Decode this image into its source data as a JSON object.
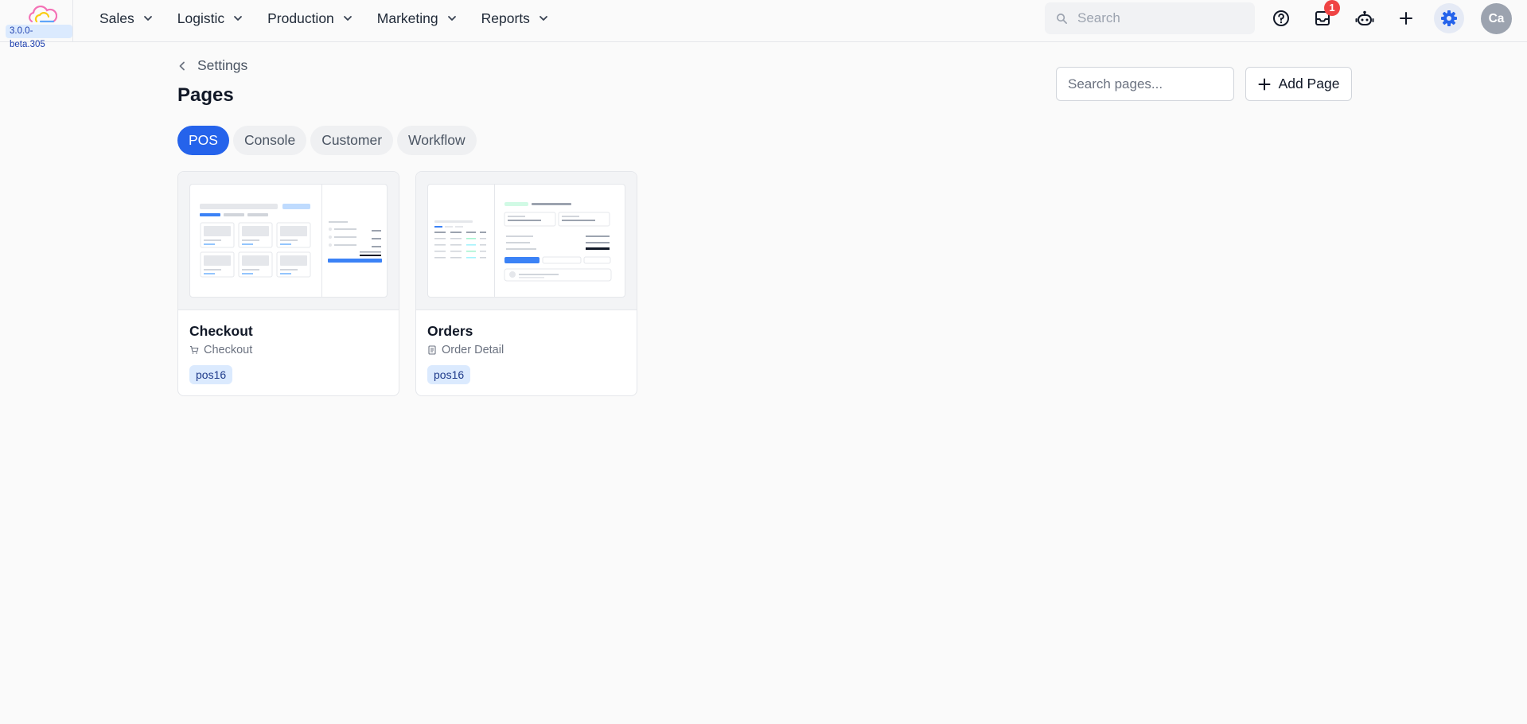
{
  "app": {
    "version": "3.0.0-beta.305"
  },
  "nav": {
    "items": [
      {
        "label": "Sales"
      },
      {
        "label": "Logistic"
      },
      {
        "label": "Production"
      },
      {
        "label": "Marketing"
      },
      {
        "label": "Reports"
      }
    ]
  },
  "topbar": {
    "search_placeholder": "Search",
    "inbox_badge": "1",
    "avatar_initials": "Ca",
    "icons": [
      "help-icon",
      "inbox-icon",
      "bot-icon",
      "plus-icon",
      "gear-icon"
    ],
    "accent_color": "#2563eb"
  },
  "header": {
    "back_label": "Settings",
    "title": "Pages",
    "search_placeholder": "Search pages...",
    "add_label": "Add Page"
  },
  "tabs": [
    {
      "label": "POS",
      "active": true
    },
    {
      "label": "Console",
      "active": false
    },
    {
      "label": "Customer",
      "active": false
    },
    {
      "label": "Workflow",
      "active": false
    }
  ],
  "cards": [
    {
      "title": "Checkout",
      "subtitle": "Checkout",
      "icon": "cart-icon",
      "tag": "pos16"
    },
    {
      "title": "Orders",
      "subtitle": "Order Detail",
      "icon": "document-icon",
      "tag": "pos16"
    }
  ]
}
